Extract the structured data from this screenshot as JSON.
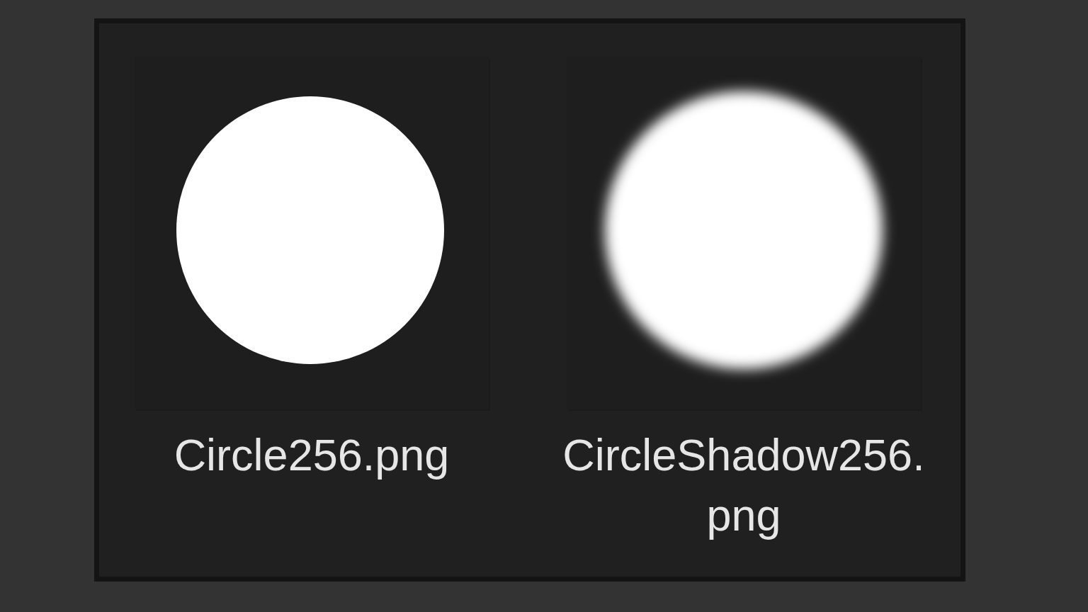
{
  "files": [
    {
      "name": "Circle256.png",
      "kind": "sharp"
    },
    {
      "name": "CircleShadow256.png",
      "kind": "soft"
    }
  ]
}
